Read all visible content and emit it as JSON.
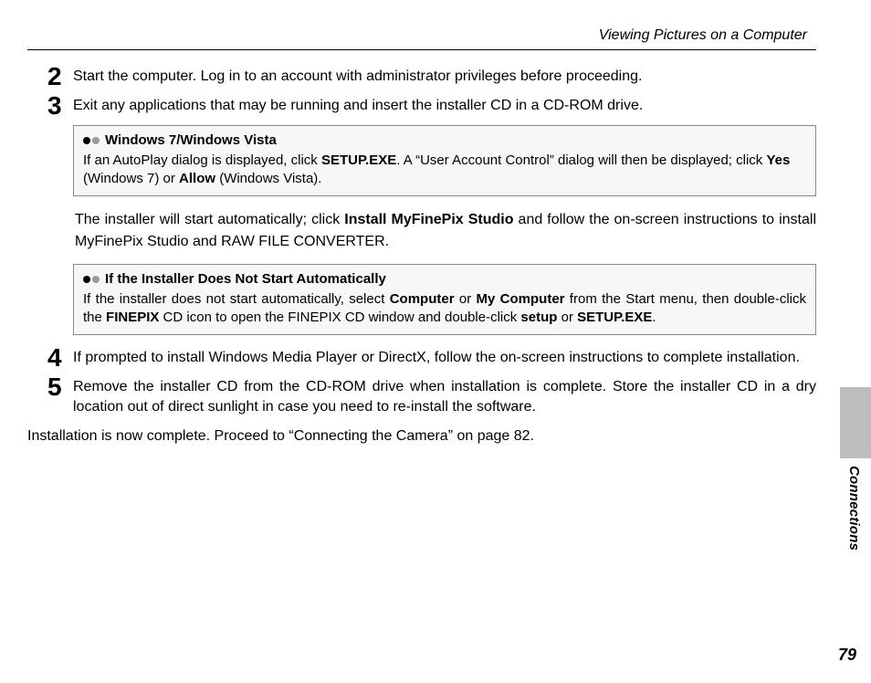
{
  "header": {
    "title": "Viewing Pictures on a Computer"
  },
  "steps": {
    "s2": {
      "num": "2",
      "text": "Start the computer.  Log in to an account with administrator privileges before proceeding."
    },
    "s3": {
      "num": "3",
      "text": "Exit any applications that may be running and insert the installer CD in a CD-ROM drive."
    },
    "s4": {
      "num": "4",
      "text": "If prompted to install Windows Media Player or DirectX, follow the on-screen instructions to complete installation."
    },
    "s5": {
      "num": "5",
      "text": "Remove the installer CD from the CD-ROM drive when installation is complete.  Store the installer CD in a dry location out of direct sunlight in case you need to re-install the software."
    }
  },
  "box1": {
    "title": "Windows 7/Windows Vista",
    "p1a": "If an AutoPlay dialog is displayed, click ",
    "p1b": "SETUP.EXE",
    "p1c": ".  A “User Account Control” dialog will then be displayed; click ",
    "p1d": "Yes",
    "p1e": " (Windows 7) or ",
    "p1f": "Allow",
    "p1g": " (Windows Vista)."
  },
  "mid": {
    "a": "The installer will start automatically; click ",
    "b": "Install MyFinePix Studio",
    "c": " and follow the on-screen instructions to install MyFinePix Studio and RAW FILE CONVERTER."
  },
  "box2": {
    "title": "If the Installer Does Not Start Automatically",
    "a": "If the installer does not start automatically, select ",
    "b": "Computer",
    "c": " or ",
    "d": "My Computer",
    "e": " from the Start menu, then double-click the ",
    "f": "FINEPIX",
    "g": " CD icon to open the FINEPIX CD window and double-click ",
    "h": "setup",
    "i": " or ",
    "j": "SETUP.EXE",
    "k": "."
  },
  "final": "Installation is now complete.  Proceed to “Connecting the Camera” on page 82.",
  "side": {
    "section": "Connections"
  },
  "pagenum": "79"
}
